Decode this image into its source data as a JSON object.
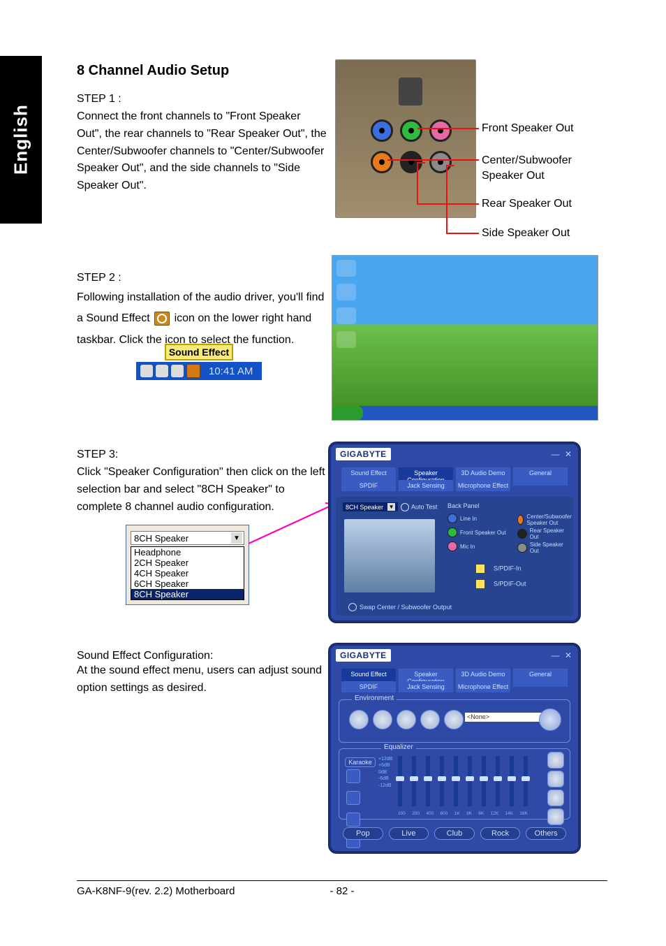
{
  "page": {
    "language_tab": "English",
    "title": "8 Channel Audio Setup",
    "footer_left": "GA-K8NF-9(rev. 2.2)  Motherboard",
    "footer_center": "- 82 -"
  },
  "step1": {
    "heading": "STEP 1 :",
    "body": "Connect the front channels to \"Front Speaker Out\", the rear channels to \"Rear Speaker Out\", the Center/Subwoofer channels to \"Center/Subwoofer Speaker Out\", and the side channels to \"Side Speaker Out\".",
    "callouts": {
      "front": "Front Speaker Out",
      "center": "Center/Subwoofer Speaker Out",
      "rear": "Rear Speaker Out",
      "side": "Side Speaker Out"
    }
  },
  "step2": {
    "heading": "STEP 2 :",
    "body_before_icon": "Following installation of the audio driver, you'll find a Sound Effect ",
    "body_after_icon": " icon on the lower right hand taskbar.  Click the icon to select the function.",
    "tooltip_label": "Sound Effect",
    "tray_time": "10:41 AM"
  },
  "step3": {
    "heading": "STEP 3:",
    "body": "Click \"Speaker Configuration\" then click on the left selection bar and select \"8CH Speaker\" to complete 8 channel audio configuration.",
    "dropdown": {
      "selected": "8CH Speaker",
      "options": [
        "Headphone",
        "2CH Speaker",
        "4CH Speaker",
        "6CH Speaker",
        "8CH Speaker"
      ]
    },
    "panel": {
      "brand": "GIGABYTE",
      "window_controls": "— ✕",
      "tabs_top": [
        "Sound Effect",
        "Speaker Configuration",
        "3D Audio Demo",
        "General"
      ],
      "tabs_bottom": [
        "SPDIF",
        "Jack Sensing",
        "Microphone Effect"
      ],
      "auto_test": "Auto Test",
      "back_panel": "Back Panel",
      "jacks": {
        "line_in": "Line In",
        "front_out": "Front Speaker Out",
        "mic_in": "Mic In",
        "center": "Center/Subwoofer Speaker Out",
        "rear": "Rear Speaker Out",
        "side": "Side Speaker Out"
      },
      "spdif_in": "S/PDIF-In",
      "spdif_out": "S/PDIF-Out",
      "swap": "Swap Center / Subwoofer Output"
    }
  },
  "sound_effect": {
    "heading": "Sound Effect Configuration:",
    "body": "At the sound effect menu, users can adjust sound option settings as desired.",
    "panel": {
      "brand": "GIGABYTE",
      "tabs_top": [
        "Sound Effect",
        "Speaker Configuration",
        "3D Audio Demo",
        "General"
      ],
      "tabs_bottom": [
        "SPDIF",
        "Jack Sensing",
        "Microphone Effect"
      ],
      "environment_label": "Environment",
      "environment_value": "<None>",
      "equalizer_label": "Equalizer",
      "karaoke_label": "Karaoke",
      "db_scale": [
        "+12dB",
        "+6dB",
        "0dB",
        "-6dB",
        "-12dB"
      ],
      "freqs": [
        "100",
        "200",
        "400",
        "600",
        "1K",
        "3K",
        "6K",
        "12K",
        "14K",
        "16K"
      ],
      "presets": [
        "Pop",
        "Live",
        "Club",
        "Rock",
        "Others"
      ]
    }
  }
}
